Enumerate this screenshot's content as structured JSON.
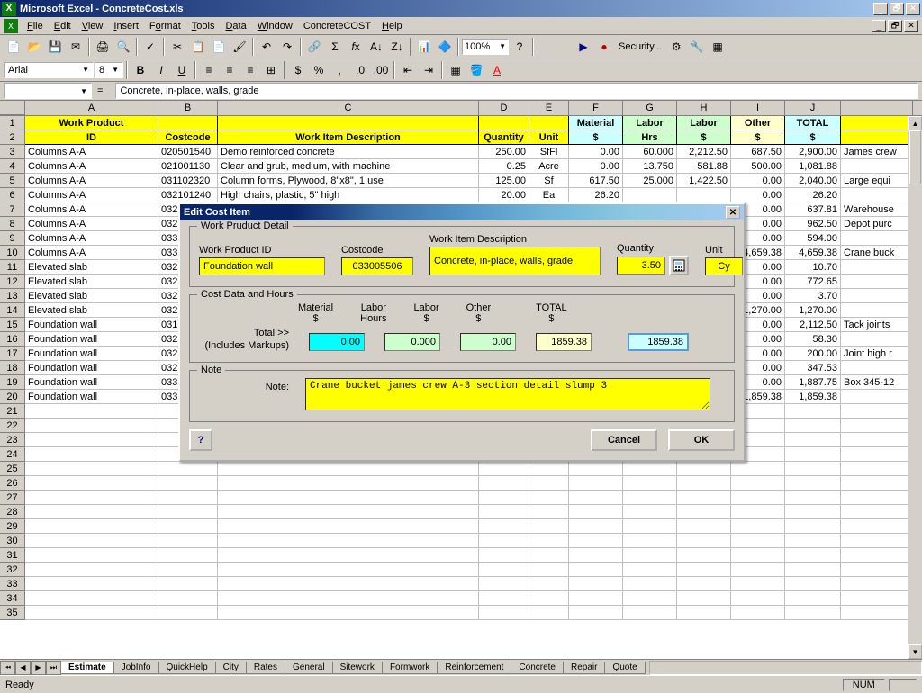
{
  "app": {
    "title": "Microsoft Excel - ConcreteCost.xls"
  },
  "menus": [
    "File",
    "Edit",
    "View",
    "Insert",
    "Format",
    "Tools",
    "Data",
    "Window",
    "ConcreteCOST",
    "Help"
  ],
  "zoom": "100%",
  "security_label": "Security...",
  "font": {
    "name": "Arial",
    "size": "8"
  },
  "formula": {
    "name_box": "",
    "content": "Concrete, in-place, walls, grade"
  },
  "columns": [
    "A",
    "B",
    "C",
    "D",
    "E",
    "F",
    "G",
    "H",
    "I",
    "J"
  ],
  "header_row1": {
    "A": "Work Product",
    "B": "",
    "C": "",
    "D": "",
    "E": "",
    "F": "Material",
    "G": "Labor",
    "H": "Labor",
    "I": "Other",
    "J": "TOTAL"
  },
  "header_row2": {
    "A": "ID",
    "B": "Costcode",
    "C": "Work Item Description",
    "D": "Quantity",
    "E": "Unit",
    "F": "$",
    "G": "Hrs",
    "H": "$",
    "I": "$",
    "J": "$"
  },
  "rows": [
    {
      "A": "Columns A-A",
      "B": "020501540",
      "C": "Demo reinforced concrete",
      "D": "250.00",
      "E": "SfFl",
      "F": "0.00",
      "G": "60.000",
      "H": "2,212.50",
      "I": "687.50",
      "J": "2,900.00",
      "K": "James crew"
    },
    {
      "A": "Columns A-A",
      "B": "021001130",
      "C": "Clear and grub, medium, with machine",
      "D": "0.25",
      "E": "Acre",
      "F": "0.00",
      "G": "13.750",
      "H": "581.88",
      "I": "500.00",
      "J": "1,081.88",
      "K": ""
    },
    {
      "A": "Columns A-A",
      "B": "031102320",
      "C": "Column forms, Plywood, 8\"x8\", 1 use",
      "D": "125.00",
      "E": "Sf",
      "F": "617.50",
      "G": "25.000",
      "H": "1,422.50",
      "I": "0.00",
      "J": "2,040.00",
      "K": "Large equi"
    },
    {
      "A": "Columns A-A",
      "B": "032101240",
      "C": "High chairs, plastic, 5\" high",
      "D": "20.00",
      "E": "Ea",
      "F": "26.20",
      "G": "",
      "H": "",
      "I": "0.00",
      "J": "26.20",
      "K": ""
    },
    {
      "A": "Columns A-A",
      "B": "032",
      "C": "",
      "D": "",
      "E": "",
      "F": "",
      "G": "",
      "H": "",
      "I": "0.00",
      "J": "637.81",
      "K": "Warehouse"
    },
    {
      "A": "Columns A-A",
      "B": "032",
      "C": "",
      "D": "",
      "E": "",
      "F": "",
      "G": "",
      "H": "",
      "I": "0.00",
      "J": "962.50",
      "K": "Depot purc"
    },
    {
      "A": "Columns A-A",
      "B": "033",
      "C": "",
      "D": "",
      "E": "",
      "F": "",
      "G": "",
      "H": "",
      "I": "0.00",
      "J": "594.00",
      "K": ""
    },
    {
      "A": "Columns A-A",
      "B": "033",
      "C": "",
      "D": "",
      "E": "",
      "F": "",
      "G": "",
      "H": "",
      "I": "4,659.38",
      "J": "4,659.38",
      "K": "Crane buck"
    },
    {
      "A": "Elevated slab",
      "B": "032",
      "C": "",
      "D": "",
      "E": "",
      "F": "",
      "G": "",
      "H": "",
      "I": "0.00",
      "J": "10.70",
      "K": ""
    },
    {
      "A": "Elevated slab",
      "B": "032",
      "C": "",
      "D": "",
      "E": "",
      "F": "",
      "G": "",
      "H": "",
      "I": "0.00",
      "J": "772.65",
      "K": ""
    },
    {
      "A": "Elevated slab",
      "B": "032",
      "C": "",
      "D": "",
      "E": "",
      "F": "",
      "G": "",
      "H": "",
      "I": "0.00",
      "J": "3.70",
      "K": ""
    },
    {
      "A": "Elevated slab",
      "B": "032",
      "C": "",
      "D": "",
      "E": "",
      "F": "",
      "G": "",
      "H": "",
      "I": "1,270.00",
      "J": "1,270.00",
      "K": ""
    },
    {
      "A": "Foundation wall",
      "B": "031",
      "C": "",
      "D": "",
      "E": "",
      "F": "",
      "G": "",
      "H": "",
      "I": "0.00",
      "J": "2,112.50",
      "K": "Tack joints"
    },
    {
      "A": "Foundation wall",
      "B": "032",
      "C": "",
      "D": "",
      "E": "",
      "F": "",
      "G": "",
      "H": "",
      "I": "0.00",
      "J": "58.30",
      "K": ""
    },
    {
      "A": "Foundation wall",
      "B": "032",
      "C": "",
      "D": "",
      "E": "",
      "F": "",
      "G": "",
      "H": "",
      "I": "0.00",
      "J": "200.00",
      "K": "Joint high r"
    },
    {
      "A": "Foundation wall",
      "B": "032",
      "C": "",
      "D": "",
      "E": "",
      "F": "",
      "G": "",
      "H": "",
      "I": "0.00",
      "J": "347.53",
      "K": ""
    },
    {
      "A": "Foundation wall",
      "B": "033",
      "C": "",
      "D": "",
      "E": "",
      "F": "",
      "G": "",
      "H": "",
      "I": "0.00",
      "J": "1,887.75",
      "K": "Box 345-12"
    },
    {
      "A": "Foundation wall",
      "B": "033",
      "C": "",
      "D": "",
      "E": "",
      "F": "",
      "G": "",
      "H": "",
      "I": "1,859.38",
      "J": "1,859.38",
      "K": ""
    }
  ],
  "empty_row_count": 15,
  "tabs": [
    "Estimate",
    "JobInfo",
    "QuickHelp",
    "City",
    "Rates",
    "General",
    "Sitework",
    "Formwork",
    "Reinforcement",
    "Concrete",
    "Repair",
    "Quote"
  ],
  "active_tab": "Estimate",
  "status": {
    "ready": "Ready",
    "num": "NUM"
  },
  "dialog": {
    "title": "Edit Cost Item",
    "group1": "Work Pruduct Detail",
    "work_product_id_label": "Work Product ID",
    "work_product_id": "Foundation wall",
    "costcode_label": "Costcode",
    "costcode": "033005506",
    "desc_label": "Work Item Description",
    "desc": "Concrete, in-place, walls, grade",
    "qty_label": "Quantity",
    "qty": "3.50",
    "unit_label": "Unit",
    "unit": "Cy",
    "group2": "Cost Data and Hours",
    "material_label": "Material\n$",
    "labor_hours_label": "Labor\nHours",
    "labor_dollar_label": "Labor\n$",
    "other_label": "Other\n$",
    "total_col_label": "TOTAL\n$",
    "total_label": "Total >>",
    "includes": "(Includes Markups)",
    "material": "0.00",
    "labor_hours": "0.000",
    "labor_dollar": "0.00",
    "other": "1859.38",
    "total": "1859.38",
    "group3": "Note",
    "note_label": "Note:",
    "note": "Crane bucket james crew A-3 section detail slump 3",
    "cancel": "Cancel",
    "ok": "OK"
  }
}
